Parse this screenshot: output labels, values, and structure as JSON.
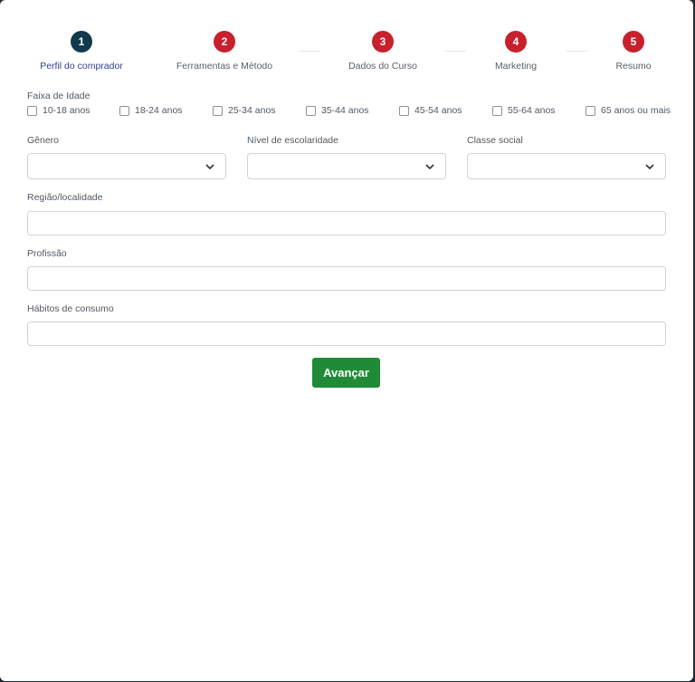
{
  "stepper": {
    "steps": [
      {
        "number": "1",
        "label": "Perfil do comprador",
        "state": "active"
      },
      {
        "number": "2",
        "label": "Ferramentas e Método",
        "state": "pending"
      },
      {
        "number": "3",
        "label": "Dados do Curso",
        "state": "pending"
      },
      {
        "number": "4",
        "label": "Marketing",
        "state": "pending"
      },
      {
        "number": "5",
        "label": "Resumo",
        "state": "pending"
      }
    ]
  },
  "age": {
    "label": "Faixa de Idade",
    "options": [
      "10-18 anos",
      "18-24 anos",
      "25-34 anos",
      "35-44 anos",
      "45-54 anos",
      "55-64 anos",
      "65 anos ou mais"
    ]
  },
  "fields": {
    "gender": {
      "label": "Gênero",
      "value": ""
    },
    "education": {
      "label": "Nível de escolaridade",
      "value": ""
    },
    "social_class": {
      "label": "Classe social",
      "value": ""
    },
    "region": {
      "label": "Região/localidade",
      "value": ""
    },
    "profession": {
      "label": "Profissão",
      "value": ""
    },
    "habits": {
      "label": "Hábitos de consumo",
      "value": ""
    }
  },
  "actions": {
    "next_label": "Avançar"
  },
  "colors": {
    "active_step": "#133a4c",
    "pending_step": "#c8202c",
    "primary_button": "#1f8a37"
  },
  "icons": {
    "select_arrow": "chevron-down-icon",
    "checkbox": "checkbox-unchecked-icon"
  }
}
